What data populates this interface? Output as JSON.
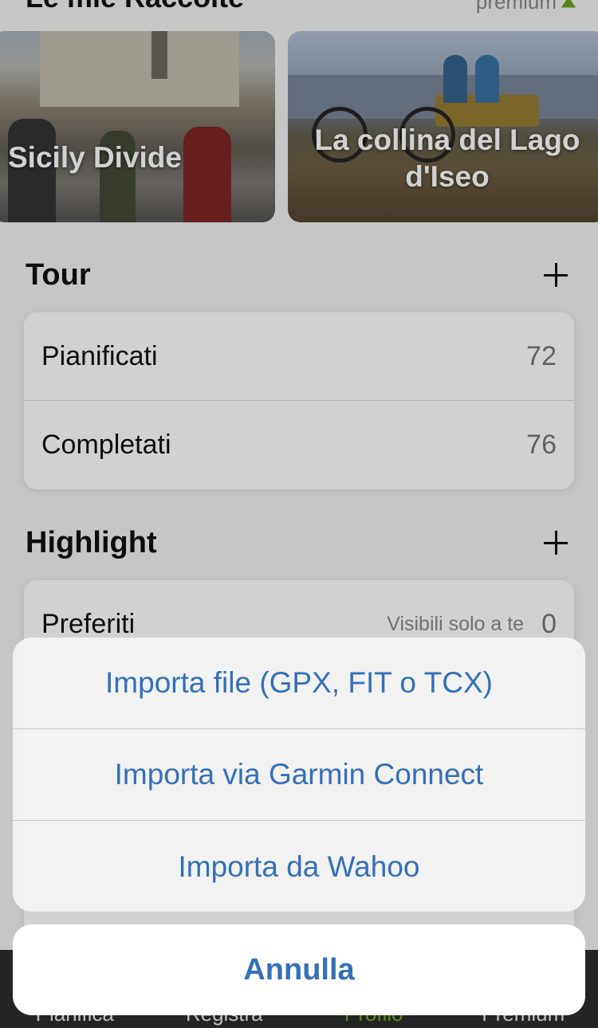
{
  "collections": {
    "title": "Le mie Raccolte",
    "premium_label": "premium",
    "cards": [
      {
        "title": "Sicily Divide"
      },
      {
        "title": "La collina del Lago d'Iseo"
      }
    ]
  },
  "tour": {
    "title": "Tour",
    "rows": [
      {
        "label": "Pianificati",
        "count": "72"
      },
      {
        "label": "Completati",
        "count": "76"
      }
    ]
  },
  "highlight": {
    "title": "Highlight",
    "rows": [
      {
        "label": "Preferiti",
        "note": "Visibili solo a te",
        "count": "0"
      }
    ]
  },
  "tabbar": {
    "items": [
      {
        "label": "Pianifica"
      },
      {
        "label": "Registra"
      },
      {
        "label": "Profilo"
      },
      {
        "label": "Premium"
      }
    ],
    "active_color": "#6aa71c"
  },
  "action_sheet": {
    "options": [
      {
        "label": "Importa file (GPX, FIT o TCX)"
      },
      {
        "label": "Importa via Garmin Connect"
      },
      {
        "label": "Importa da Wahoo"
      }
    ],
    "cancel_label": "Annulla",
    "accent_color": "#3470b7"
  }
}
